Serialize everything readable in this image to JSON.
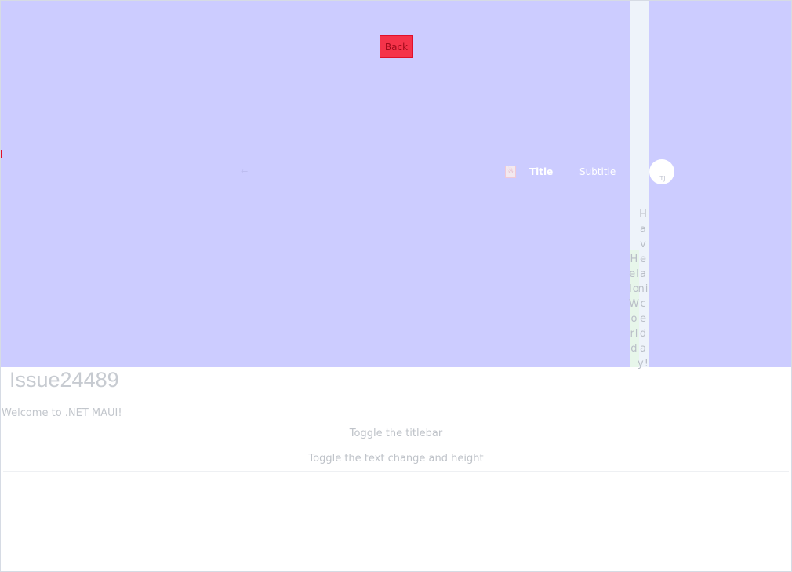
{
  "titlebar": {
    "back_label": "Back",
    "title": "Title",
    "subtitle": "Subtitle",
    "app_icon": "app-icon",
    "avatar_initials": "TJ",
    "content": {
      "hello_vertical": "H\nel\nlo\nW\no\nrl\nd",
      "haveday_vertical": "H\na\nv\ne\na\nni\nc\ne\nd\na\ny!"
    }
  },
  "page": {
    "title": "Issue24489",
    "welcome_text": "Welcome to .NET MAUI!",
    "toggle_titlebar_label": "Toggle the titlebar",
    "toggle_text_label": "Toggle the text change and height"
  },
  "colors": {
    "titlebar_bg": "#ccccff",
    "back_button_bg": "#f5334a",
    "page_bg": "#ffffff"
  }
}
